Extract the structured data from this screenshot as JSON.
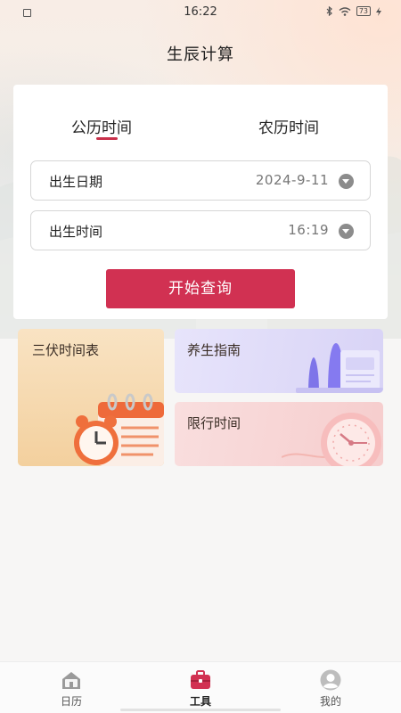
{
  "status_bar": {
    "time": "16:22",
    "battery": "73",
    "icons": [
      "notification-icon",
      "bluetooth-icon",
      "wifi-icon",
      "battery-icon",
      "charging-icon"
    ]
  },
  "header": {
    "title": "生辰计算"
  },
  "query": {
    "tabs": [
      {
        "label": "公历时间",
        "active": true
      },
      {
        "label": "农历时间",
        "active": false
      }
    ],
    "birth_date": {
      "label": "出生日期",
      "value": "2024-9-11"
    },
    "birth_time": {
      "label": "出生时间",
      "value": "16:19"
    },
    "submit_label": "开始查询"
  },
  "tools": {
    "sanfu": {
      "title": "三伏时间表",
      "icon": "alarm-clock-calendar-icon"
    },
    "health": {
      "title": "养生指南",
      "icon": "health-chart-icon"
    },
    "traffic": {
      "title": "限行时间",
      "icon": "clock-icon"
    }
  },
  "nav": {
    "items": [
      {
        "label": "日历",
        "icon": "calendar-home-icon",
        "active": false
      },
      {
        "label": "工具",
        "icon": "toolbox-icon",
        "active": true
      },
      {
        "label": "我的",
        "icon": "user-avatar-icon",
        "active": false
      }
    ]
  },
  "colors": {
    "accent": "#d13152",
    "tab_underline": "#c9314b",
    "sanfu_card": "#f6d9b0",
    "health_card": "#dedaf8",
    "traffic_card": "#f8d6d6"
  }
}
